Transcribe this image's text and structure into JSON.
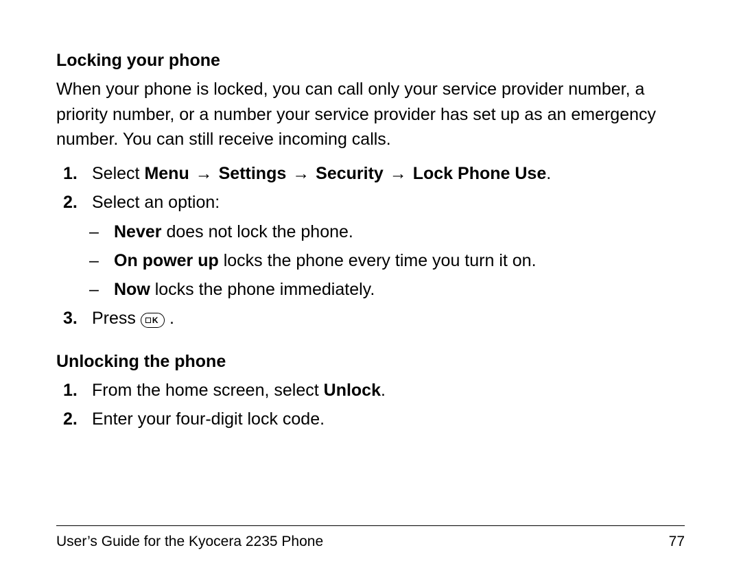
{
  "section1": {
    "heading": "Locking your phone",
    "intro": "When your phone is locked, you can call only your service provider number, a priority number, or a number your service provider has set up as an emergency number. You can still receive incoming calls.",
    "step1": {
      "marker": "1.",
      "prefix": "Select ",
      "path_menu": "Menu",
      "path_settings": "Settings",
      "path_security": "Security",
      "path_lock": "Lock Phone Use",
      "suffix": "."
    },
    "step2": {
      "marker": "2.",
      "text": "Select an option:",
      "opt_a_bold": "Never",
      "opt_a_rest": " does not lock the phone.",
      "opt_b_bold": "On power up",
      "opt_b_rest": " locks the phone every time you turn it on.",
      "opt_c_bold": "Now",
      "opt_c_rest": " locks the phone immediately."
    },
    "step3": {
      "marker": "3.",
      "prefix": "Press ",
      "suffix": " ."
    }
  },
  "section2": {
    "heading": "Unlocking the phone",
    "step1": {
      "marker": "1.",
      "prefix": "From the home screen, select ",
      "bold": "Unlock",
      "suffix": "."
    },
    "step2": {
      "marker": "2.",
      "text": "Enter your four-digit lock code."
    }
  },
  "footer": {
    "title": "User’s Guide for the Kyocera 2235 Phone",
    "page": "77"
  },
  "arrow": "→",
  "dash": "–",
  "ok_label": "K"
}
